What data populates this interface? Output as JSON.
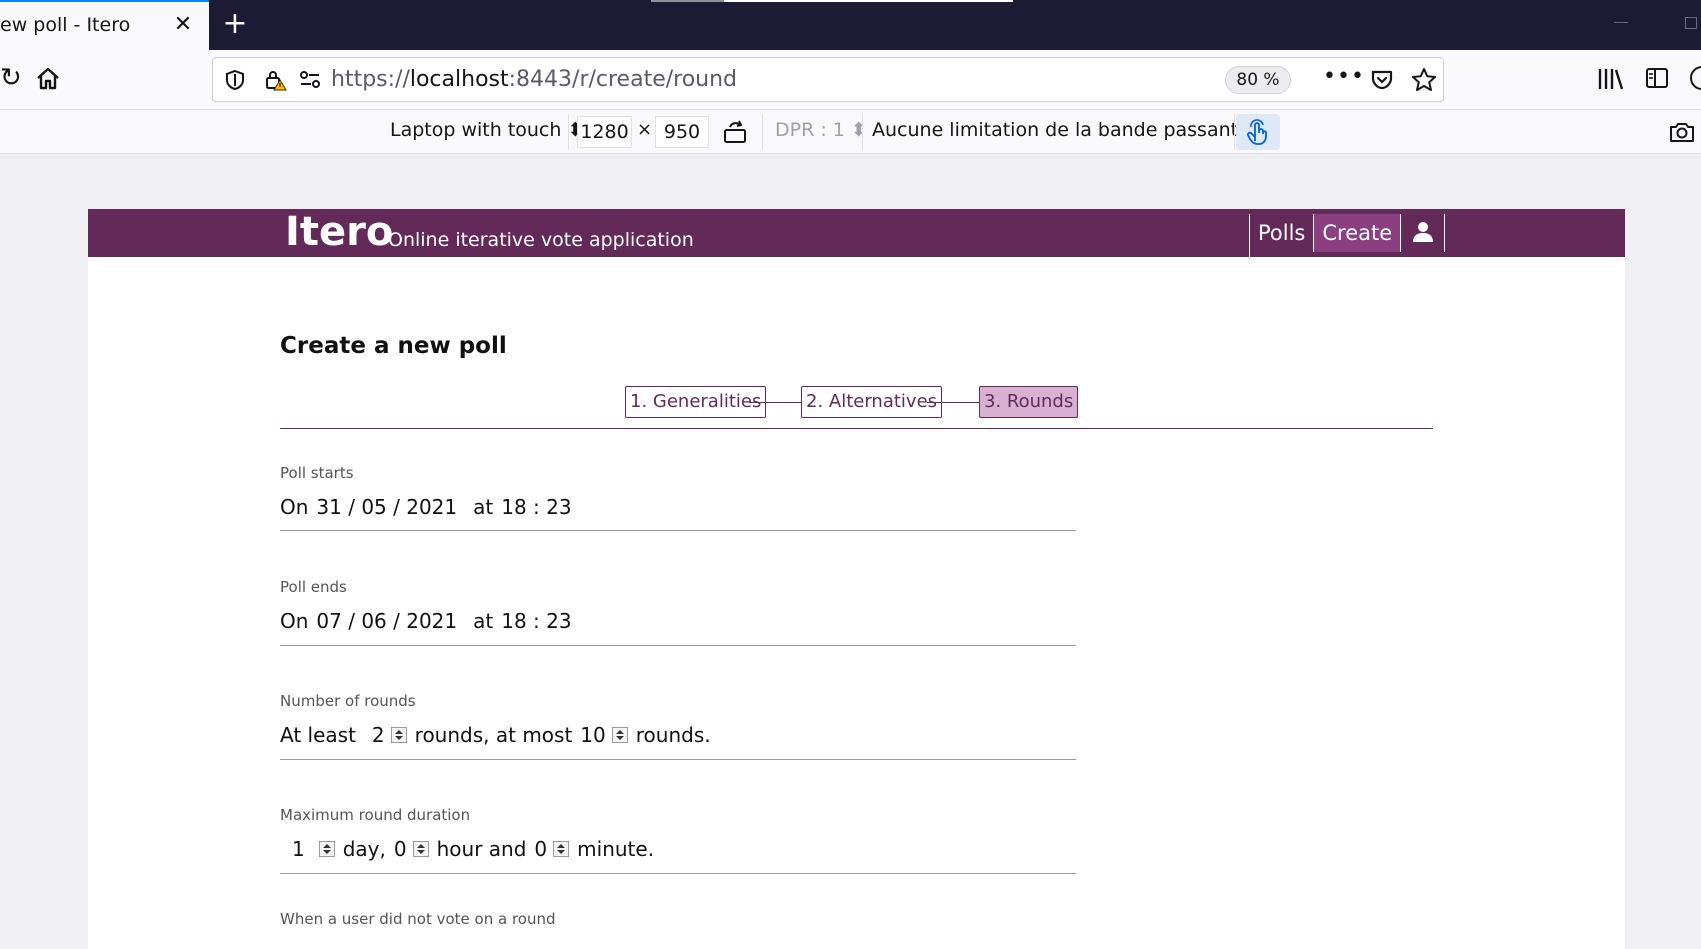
{
  "browser": {
    "tab_title": "ew poll - Itero",
    "url_scheme": "https://",
    "url_host": "localhost",
    "url_rest": ":8443/r/create/round",
    "zoom": "80 %"
  },
  "rdm": {
    "device": "Laptop with touch",
    "width": "1280",
    "times": "×",
    "height": "950",
    "dpr": "DPR : 1",
    "throttling": "Aucune limitation de la bande passante"
  },
  "app": {
    "brand": "Itero",
    "tagline": "Online iterative vote application",
    "nav": [
      "Polls",
      "Create"
    ]
  },
  "page": {
    "title": "Create a new poll",
    "steps": [
      "1. Generalities",
      "2. Alternatives",
      "3. Rounds"
    ]
  },
  "form": {
    "start": {
      "label": "Poll starts",
      "on": "On",
      "date": "31 / 05 / 2021",
      "at": "at",
      "time": "18 : 23"
    },
    "end": {
      "label": "Poll ends",
      "on": "On",
      "date": "07 / 06 / 2021",
      "at": "at",
      "time": "18 : 23"
    },
    "rounds": {
      "label": "Number of rounds",
      "prefix": "At least",
      "min": "2",
      "middle": "rounds, at most",
      "max": "10",
      "suffix": "rounds."
    },
    "duration": {
      "label": "Maximum round duration",
      "days": "1",
      "days_label": "day,",
      "hours": "0",
      "hours_label": "hour and",
      "minutes": "0",
      "minutes_label": "minute."
    },
    "novote_label": "When a user did not vote on a round"
  },
  "colors": {
    "brand": "#632a59",
    "brand_active": "#8b3e80",
    "step_current": "#d8b0d2",
    "browser_frame": "#1c1b33",
    "accent": "#0a84ff"
  },
  "icons": [
    "close-icon",
    "plus-icon",
    "reload-icon",
    "home-icon",
    "shield-icon",
    "insecure-lock-icon",
    "permissions-icon",
    "more-icon",
    "pocket-icon",
    "star-icon",
    "library-icon",
    "sidebar-icon",
    "account-icon",
    "rotate-icon",
    "touch-icon",
    "camera-icon",
    "user-icon",
    "spinner-icon"
  ]
}
